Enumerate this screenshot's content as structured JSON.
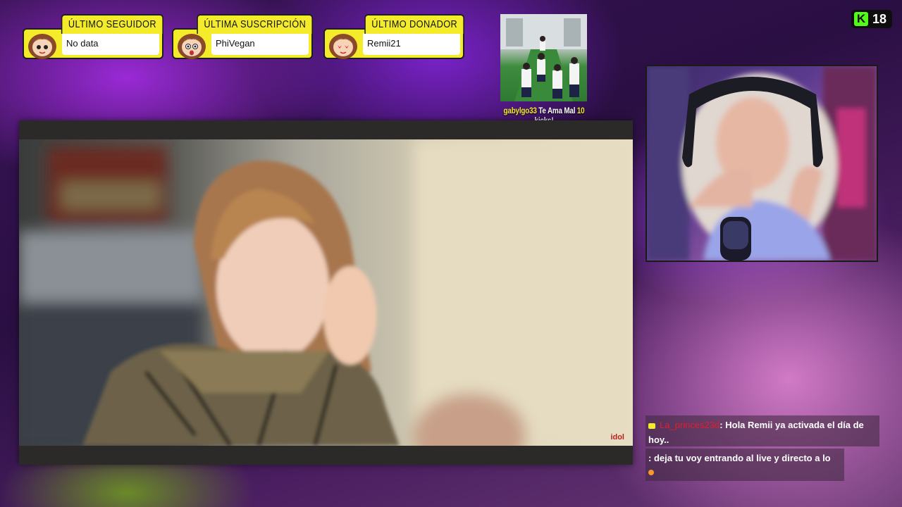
{
  "alerts": [
    {
      "title": "ÚLTIMO SEGUIDOR",
      "value": "No data"
    },
    {
      "title": "ÚLTIMA SUSCRIPCIÓN",
      "value": "PhiVegan"
    },
    {
      "title": "ÚLTIMO DONADOR",
      "value": "Remii21"
    }
  ],
  "kick_alert": {
    "user": "gabylgo33",
    "mid": "Te Ama Mal",
    "count": "10",
    "suffix": "kicks!"
  },
  "viewer_badge": {
    "platform_letter": "K",
    "count": "18"
  },
  "video": {
    "watermark": "idol"
  },
  "chat": [
    {
      "user": "La_princes23d",
      "text": ": Hola Remii ya activada el día de hoy.."
    },
    {
      "user": "",
      "text": ": deja tu voy entrando al live y directo a lo"
    }
  ],
  "colors": {
    "alert_yellow": "#f4ec2a",
    "kick_green": "#53fc18",
    "chat_user_red": "#e01e2e"
  }
}
